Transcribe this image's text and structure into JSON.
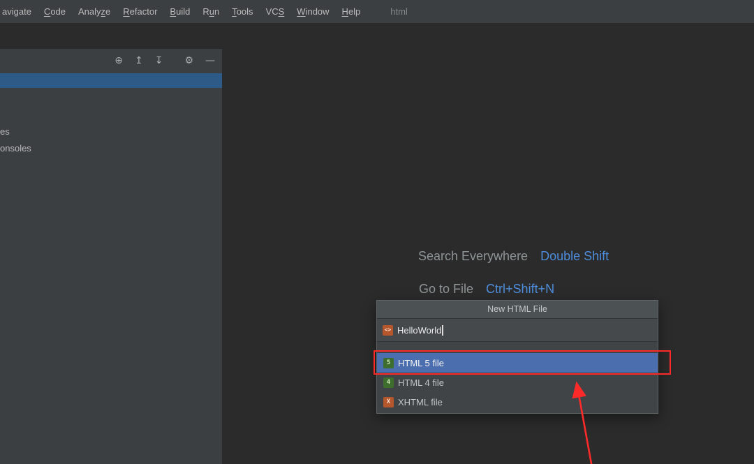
{
  "menu": {
    "items": [
      {
        "label": "avigate",
        "mnemonic": -1
      },
      {
        "label": "Code",
        "mnemonic": 0
      },
      {
        "label": "Analyze",
        "mnemonic": 5
      },
      {
        "label": "Refactor",
        "mnemonic": 0
      },
      {
        "label": "Build",
        "mnemonic": 0
      },
      {
        "label": "Run",
        "mnemonic": 1
      },
      {
        "label": "Tools",
        "mnemonic": 0
      },
      {
        "label": "VCS",
        "mnemonic": 2
      },
      {
        "label": "Window",
        "mnemonic": 0
      },
      {
        "label": "Help",
        "mnemonic": 0
      }
    ],
    "window_title": "html"
  },
  "project_panel": {
    "toolbar_icons": [
      {
        "name": "locate-file-icon",
        "glyph": "⊕",
        "gap_before": false
      },
      {
        "name": "expand-all-icon",
        "glyph": "↥",
        "gap_before": false
      },
      {
        "name": "collapse-all-icon",
        "glyph": "↧",
        "gap_before": false
      },
      {
        "name": "settings-gear-icon",
        "glyph": "⚙",
        "gap_before": true
      },
      {
        "name": "hide-panel-icon",
        "glyph": "—",
        "gap_before": false
      }
    ],
    "partial_items": [
      "es",
      "onsoles"
    ]
  },
  "editor": {
    "shortcuts": [
      {
        "label": "Search Everywhere",
        "key": "Double Shift"
      },
      {
        "label": "Go to File",
        "key": "Ctrl+Shift+N"
      }
    ]
  },
  "dialog": {
    "title": "New HTML File",
    "input_value": "HelloWorld",
    "input_icon": "html-file-icon",
    "input_icon_glyph": "<>",
    "options": [
      {
        "label": "HTML 5 file",
        "icon": "html5-file-icon",
        "glyph": "5",
        "style": "green",
        "selected": true
      },
      {
        "label": "HTML 4 file",
        "icon": "html4-file-icon",
        "glyph": "4",
        "style": "green",
        "selected": false
      },
      {
        "label": "XHTML file",
        "icon": "xhtml-file-icon",
        "glyph": "X",
        "style": "orange",
        "selected": false
      }
    ]
  },
  "colors": {
    "menu_bg": "#3c3f41",
    "editor_bg": "#2b2b2b",
    "panel_bg": "#3c3f41",
    "dialog_bg": "#404446",
    "dialog_header_bg": "#4c5154",
    "input_bg": "#45494c",
    "selection_blue": "#4b6eaf",
    "tree_selection_blue": "#2d5a87",
    "link_blue": "#4e8ddb",
    "annotation_red": "#fd2a2a"
  }
}
